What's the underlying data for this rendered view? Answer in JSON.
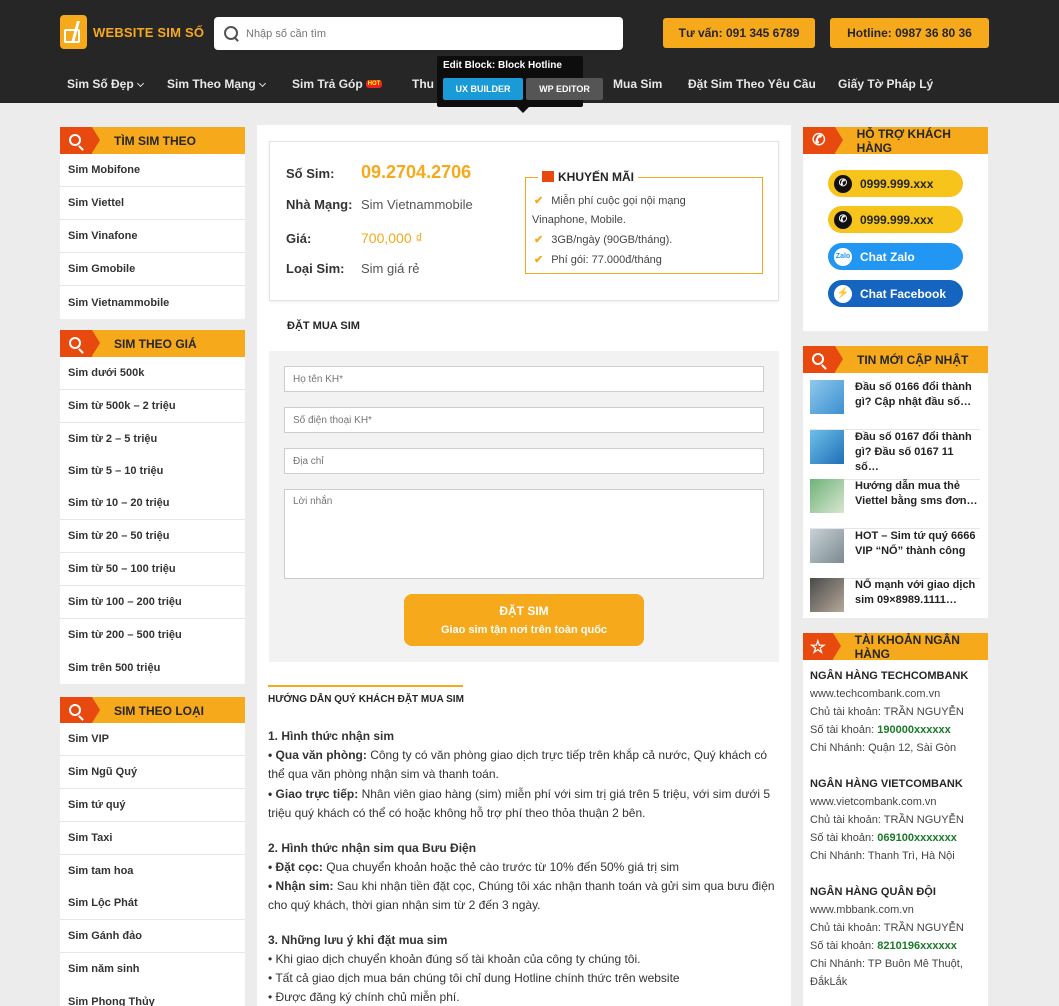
{
  "header": {
    "logo": "WEBSITE SIM SỐ",
    "search_placeholder": "Nhập số cần tìm",
    "consult_btn": "Tư vấn: 091 345 6789",
    "hotline_btn": "Hotline: 0987 36 80 36",
    "nav": [
      "Sim Số Đẹp",
      "Sim Theo Mạng",
      "Sim Trả Góp",
      "Thu",
      "Mua Sim",
      "Đặt Sim Theo Yêu Cầu",
      "Giấy Tờ Pháp Lý"
    ],
    "hot_badge": "HOT"
  },
  "edit_block": {
    "title": "Edit Block: Block Hotline",
    "ux_builder": "UX BUILDER",
    "wp_editor": "WP EDITOR"
  },
  "left": {
    "mang_title": "TÌM SIM THEO",
    "mang": [
      "Sim Mobifone",
      "Sim Viettel",
      "Sim Vinafone",
      "Sim Gmobile",
      "Sim Vietnammobile"
    ],
    "gia_title": "SIM THEO GIÁ",
    "gia": [
      "Sim dưới 500k",
      "Sim từ 500k – 2 triệu",
      "Sim từ 2 – 5 triệu",
      "Sim từ 5 – 10 triệu",
      "Sim từ 10 – 20 triệu",
      "Sim từ 20 – 50 triệu",
      "Sim từ 50 – 100 triệu",
      "Sim từ 100 – 200 triệu",
      "Sim từ 200 – 500 triệu",
      "Sim trên 500 triệu"
    ],
    "loai_title": "SIM THEO LOẠI",
    "loai": [
      "Sim VIP",
      "Sim Ngũ Quý",
      "Sim tứ quý",
      "Sim Taxi",
      "Sim tam hoa",
      "Sim Lộc Phát",
      "Sim Gánh đảo",
      "Sim năm sinh",
      "Sim Phong Thủy"
    ]
  },
  "product": {
    "so_sim_label": "Số Sim:",
    "so_sim": "09.2704.2706",
    "nha_mang_label": "Nhà Mạng:",
    "nha_mang": "Sim Vietnammobile",
    "gia_label": "Giá:",
    "gia": "700,000 ₫",
    "loai_label": "Loại Sim:",
    "loai": "Sim giá rẻ",
    "promo_title": "KHUYẾN MÃI",
    "promo_l1": "Miễn phí cuộc gọi nội mạng",
    "promo_l1b": "Vinaphone, Mobile.",
    "promo_l2": "3GB/ngày (90GB/tháng).",
    "promo_l3": "Phí gói: 77.000đ/tháng",
    "check": "✔"
  },
  "order": {
    "title": "ĐẶT MUA SIM",
    "name_ph": "Họ tên KH*",
    "phone_ph": "Số điện thoại KH*",
    "address_ph": "Địa chỉ",
    "message_ph": "Lời nhắn",
    "submit": "ĐẶT SIM",
    "submit_sub": "Giao sim tận nơi trên toàn quốc"
  },
  "guide": {
    "title": "HƯỚNG DẪN QUÝ KHÁCH ĐẶT MUA SIM",
    "h1": "1. Hình thức nhận sim",
    "p1a_b": "• Qua văn phòng:",
    "p1a": " Công ty có văn phòng giao dịch trực tiếp trên khắp cả nước, Quý khách có thể qua văn phòng nhận sim và thanh toán.",
    "p1b_b": "• Giao trực tiếp:",
    "p1b": " Nhân viên giao hàng (sim) miễn phí với sim trị giá trên 5 triệu, với sim dưới 5 triệu quý khách có thể có hoặc không hỗ trợ phí theo thỏa thuận 2 bên.",
    "h2": "2. Hình thức nhận sim qua Bưu Điện",
    "p2a_b": "• Đặt cọc:",
    "p2a": " Qua chuyển khoản hoặc thẻ cào trước từ 10% đến 50% giá trị sim",
    "p2b_b": "• Nhận sim:",
    "p2b": " Sau khi nhận tiền đặt cọc, Chúng tôi xác nhận thanh toán và gửi sim qua bưu điện cho quý khách, thời gian nhận sim từ 2 đến 3 ngày.",
    "h3": "3. Những lưu ý khi đặt mua sim",
    "p3a": "• Khi giao dịch chuyển khoản đúng số tài khoản của công ty chúng tôi.",
    "p3b": "• Tất cả giao dịch mua bán chúng tôi chỉ dung Hotline chính thức trên website",
    "p3c": "• Được đăng ký chính chủ miễn phí."
  },
  "right": {
    "support_title": "HỖ TRỢ KHÁCH HÀNG",
    "phone1": "0999.999.xxx",
    "phone2": "0999.999.xxx",
    "zalo": "Chat Zalo",
    "facebook": "Chat Facebook",
    "zalo_icon": "Zalo",
    "news_title": "TIN MỚI CẬP NHẬT",
    "news": [
      "Đầu số 0166 đổi thành gì? Cập nhật đầu số…",
      "Đầu số 0167 đổi thành gì? Đầu số 0167 11 số…",
      "Hướng dẫn mua thẻ Viettel bằng sms đơn…",
      "HOT – Sim tứ quý 6666 VIP “NỔ” thành công",
      "NỔ mạnh với giao dịch sim 09×8989.1111…"
    ],
    "bank_title": "TÀI KHOẢN NGÂN HÀNG",
    "owner_label": "Chủ tài khoản:",
    "owner": "TRẦN NGUYỄN",
    "acct_label": "Số tài khoản:",
    "branch_label": "Chi Nhánh:",
    "banks": [
      {
        "name": "NGÂN HÀNG TECHCOMBANK",
        "url": "www.techcombank.com.vn",
        "acct": "190000xxxxxx",
        "branch": "Quận 12, Sài Gòn"
      },
      {
        "name": "NGÂN HÀNG VIETCOMBANK",
        "url": "www.vietcombank.com.vn",
        "acct": "069100xxxxxxx",
        "branch": "Thanh Trì, Hà Nội"
      },
      {
        "name": "NGÂN HÀNG QUÂN ĐỘI",
        "url": "www.mbbank.com.vn",
        "acct": "8210196xxxxxx",
        "branch": "TP Buôn Mê Thuột,",
        "branch2": "ĐắkLắk"
      }
    ]
  },
  "colors": {
    "accent": "#f6a91b",
    "accent_dark": "#e8490f",
    "header_bg": "#262626",
    "zalo": "#2196f3",
    "facebook": "#1565c0"
  }
}
